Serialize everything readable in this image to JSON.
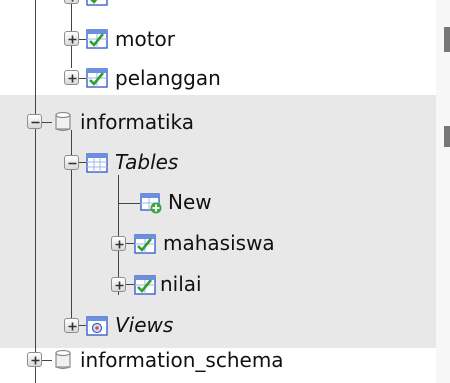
{
  "navigation_tree": {
    "items": {
      "motor": {
        "label": "motor",
        "type": "table"
      },
      "pelanggan": {
        "label": "pelanggan",
        "type": "table"
      },
      "informatika": {
        "label": "informatika",
        "type": "database",
        "expanded": true
      },
      "tables": {
        "label": "Tables",
        "type": "group",
        "expanded": true
      },
      "new": {
        "label": "New",
        "type": "action"
      },
      "mahasiswa": {
        "label": "mahasiswa",
        "type": "table"
      },
      "nilai": {
        "label": "nilai",
        "type": "table"
      },
      "views": {
        "label": "Views",
        "type": "group"
      },
      "information_schema": {
        "label": "information_schema",
        "type": "database"
      }
    }
  },
  "colors": {
    "selected_row_background": "#e8e8e8",
    "tree_line": "#444444",
    "table_icon_green": "#2e9e2e",
    "table_icon_blue": "#3a5fcd"
  }
}
